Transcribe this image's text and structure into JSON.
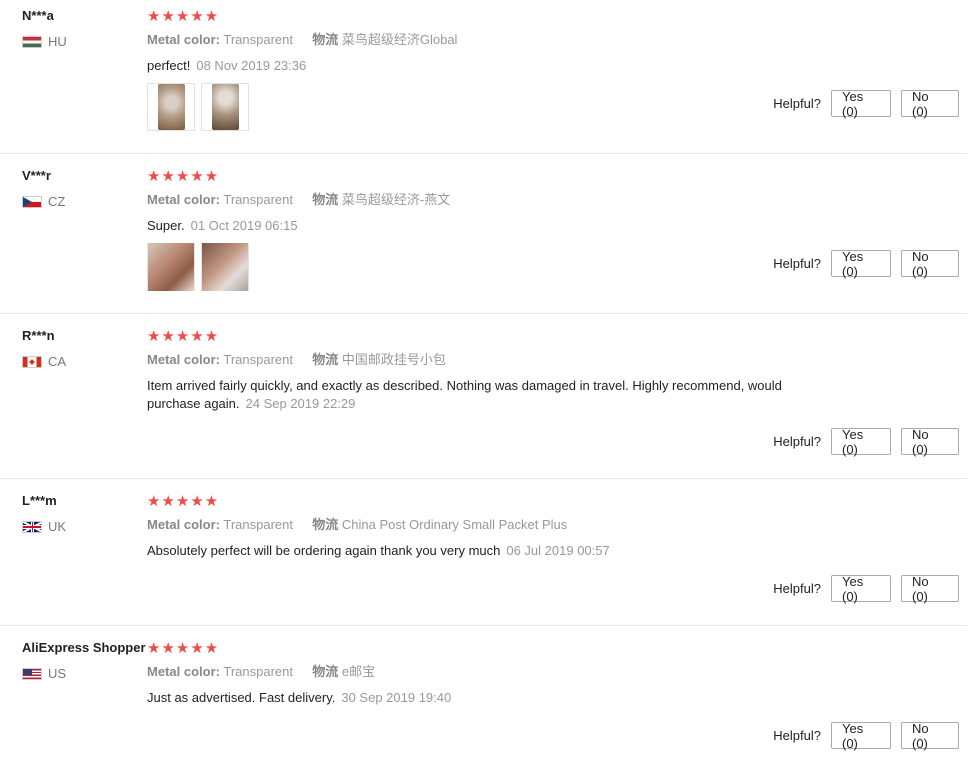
{
  "colors": {
    "star": "#ef4b4b",
    "accent_text": "#222222",
    "muted_text": "#999999"
  },
  "helpful_label": "Helpful?",
  "reviews": [
    {
      "user": "N***a",
      "country": "HU",
      "flag": "hungary",
      "stars": "★★★★★",
      "metal_color_label": "Metal color:",
      "metal_color_value": "Transparent",
      "shipping_label": "物流",
      "shipping_value": "菜鸟超级经济Global",
      "text": "perfect!",
      "date": "08 Nov 2019 23:36",
      "photos": [
        "photo-1",
        "photo-2"
      ],
      "yes": "Yes (0)",
      "no": "No (0)"
    },
    {
      "user": "V***r",
      "country": "CZ",
      "flag": "czech",
      "stars": "★★★★★",
      "metal_color_label": "Metal color:",
      "metal_color_value": "Transparent",
      "shipping_label": "物流",
      "shipping_value": "菜鸟超级经济-燕文",
      "text": "Super.",
      "date": "01 Oct 2019 06:15",
      "photos": [
        "photo-1",
        "photo-2"
      ],
      "yes": "Yes (0)",
      "no": "No (0)"
    },
    {
      "user": "R***n",
      "country": "CA",
      "flag": "canada",
      "stars": "★★★★★",
      "metal_color_label": "Metal color:",
      "metal_color_value": "Transparent",
      "shipping_label": "物流",
      "shipping_value": "中国邮政挂号小包",
      "text": "Item arrived fairly quickly, and exactly as described. Nothing was damaged in travel. Highly recommend, would purchase again.",
      "date": "24 Sep 2019 22:29",
      "photos": [],
      "yes": "Yes (0)",
      "no": "No (0)"
    },
    {
      "user": "L***m",
      "country": "UK",
      "flag": "uk",
      "stars": "★★★★★",
      "metal_color_label": "Metal color:",
      "metal_color_value": "Transparent",
      "shipping_label": "物流",
      "shipping_value": "China Post Ordinary Small Packet Plus",
      "text": "Absolutely perfect will be ordering again thank you very much",
      "date": "06 Jul 2019 00:57",
      "photos": [],
      "yes": "Yes (0)",
      "no": "No (0)"
    },
    {
      "user": "AliExpress Shopper",
      "country": "US",
      "flag": "us",
      "stars": "★★★★★",
      "metal_color_label": "Metal color:",
      "metal_color_value": "Transparent",
      "shipping_label": "物流",
      "shipping_value": "e邮宝",
      "text": "Just as advertised. Fast delivery.",
      "date": "30 Sep 2019 19:40",
      "photos": [],
      "yes": "Yes (0)",
      "no": "No (0)"
    }
  ]
}
